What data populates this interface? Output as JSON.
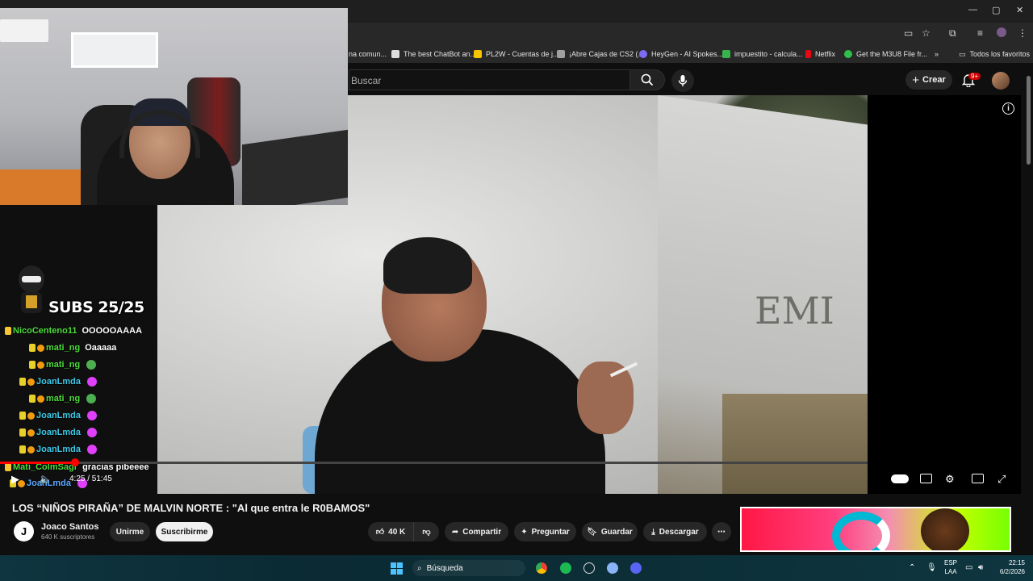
{
  "browser": {
    "window_controls": [
      "—",
      "▢",
      "✕"
    ],
    "bookmarks": [
      {
        "label": "na comun...",
        "color": "#888888"
      },
      {
        "label": "The best ChatBot an...",
        "color": "#dddddd"
      },
      {
        "label": "PL2W - Cuentas de j...",
        "color": "#f5c400"
      },
      {
        "label": "¡Abre Cajas de CS2 (...",
        "color": "#a0a0a0"
      },
      {
        "label": "HeyGen - AI Spokes...",
        "color": "#7c6cf5"
      },
      {
        "label": "impuestito - calcula...",
        "color": "#36b34a"
      },
      {
        "label": "Netflix",
        "color": "#e50914"
      },
      {
        "label": "Get the M3U8 File fr...",
        "color": "#2fbf4a"
      }
    ],
    "all_bookmarks_label": "Todos los favoritos"
  },
  "youtube": {
    "search_placeholder": "Buscar",
    "create_label": "Crear",
    "notifications_badge": "9+"
  },
  "overlay": {
    "subs_counter": "SUBS 25/25",
    "chat": [
      {
        "user": "NicoCenteno11",
        "message": "OOOOOAAAA",
        "color": "chat-user-green"
      },
      {
        "user": "mati_ng",
        "message": "Oaaaaa",
        "color": "chat-user-green"
      },
      {
        "user": "mati_ng",
        "message": "",
        "color": "chat-user-green"
      },
      {
        "user": "JoanLmda",
        "message": "",
        "color": "chat-user-cyan"
      },
      {
        "user": "mati_ng",
        "message": "",
        "color": "chat-user-green"
      },
      {
        "user": "JoanLmda",
        "message": "",
        "color": "chat-user-cyan"
      },
      {
        "user": "JoanLmda",
        "message": "",
        "color": "chat-user-cyan"
      },
      {
        "user": "JoanLmda",
        "message": "",
        "color": "chat-user-cyan"
      },
      {
        "user": "Mati_ColmSagr",
        "message": "gracias pibeeee",
        "color": "chat-user-green"
      },
      {
        "user": "JoanLmda",
        "message": "",
        "color": "chat-user-blue"
      }
    ]
  },
  "player": {
    "time": "4:25 / 51:45",
    "graffiti": "EMI",
    "progress_fraction": 0.0855
  },
  "video": {
    "title": "LOS “NIÑOS PIRAÑA” DE MALVIN NORTE : \"Al que entra le R0BAMOS\"",
    "channel_initial": "J",
    "channel_name": "Joaco Santos",
    "channel_subs": "640 K suscriptores",
    "join_label": "Unirme",
    "subscribe_label": "Suscribirme",
    "likes": "40 K",
    "share_label": "Compartir",
    "ask_label": "Preguntar",
    "save_label": "Guardar",
    "download_label": "Descargar"
  },
  "taskbar": {
    "search_label": "Búsqueda",
    "lang_top": "ESP",
    "lang_bottom": "LAA",
    "time": "22:15",
    "date": "6/2/2026"
  }
}
